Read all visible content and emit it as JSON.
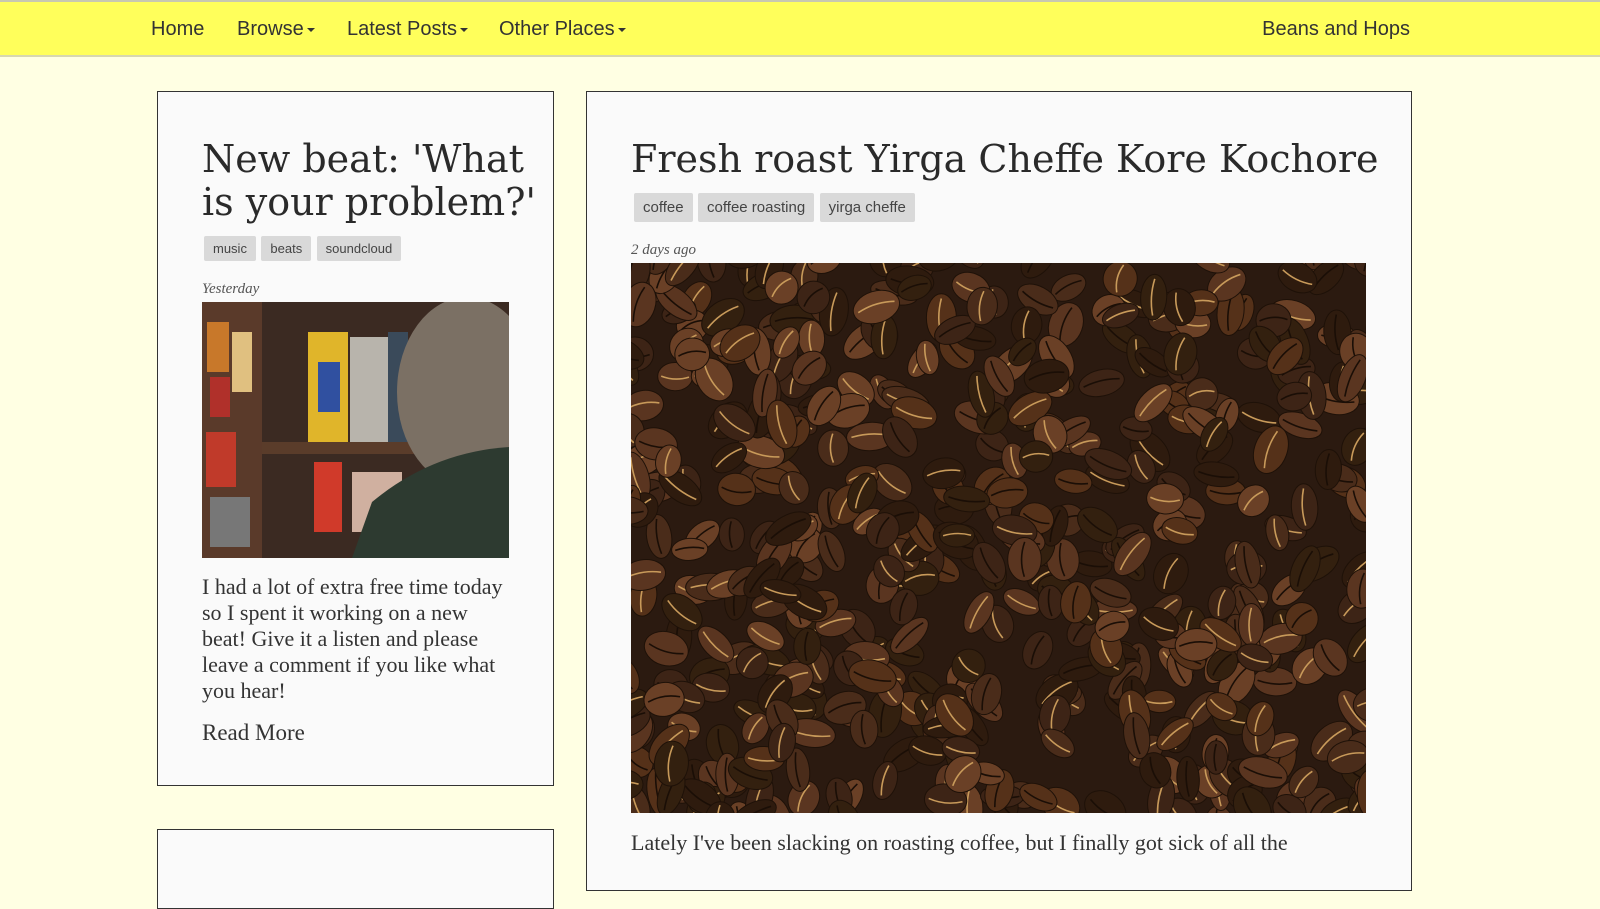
{
  "nav": {
    "home": "Home",
    "browse": "Browse",
    "latest": "Latest Posts",
    "other": "Other Places",
    "brand": "Beans and Hops"
  },
  "post1": {
    "title_line1": "New beat: 'What",
    "title_line2": "is your problem?'",
    "tags": [
      "music",
      "beats",
      "soundcloud"
    ],
    "date": "Yesterday",
    "excerpt": "I had a lot of extra free time today so I spent it working on a new beat! Give it a listen and please leave a comment if you like what you hear!",
    "read_more": "Read More"
  },
  "post2": {
    "title": "Fresh roast Yirga Cheffe Kore Kochore",
    "tags": [
      "coffee",
      "coffee roasting",
      "yirga cheffe"
    ],
    "date": "2 days ago",
    "excerpt": "Lately I've been slacking on roasting coffee, but I finally got sick of all the"
  }
}
